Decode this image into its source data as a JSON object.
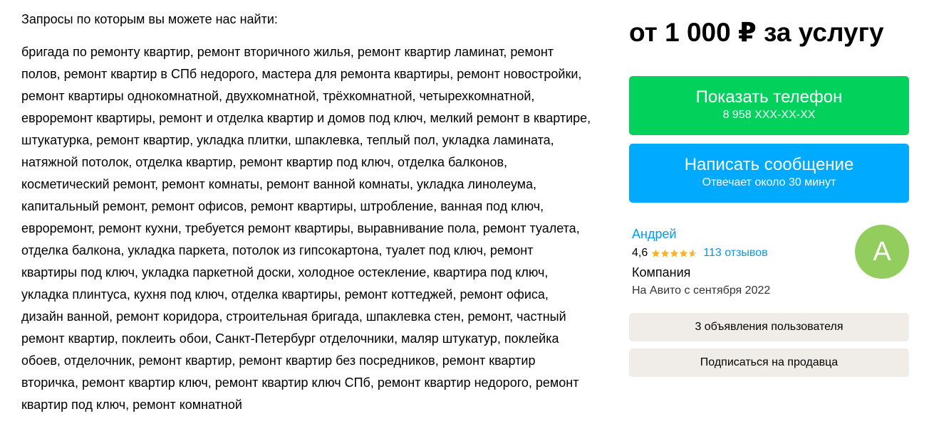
{
  "queries": {
    "heading": "Запросы по которым вы можете нас найти:",
    "text": "бригада по ремонту квартир, ремонт вторичного жилья, ремонт квартир ламинат, ремонт полов, ремонт квартир в СПб недорого, мастера для ремонта квартиры, ремонт новостройки, ремонт квартиры однокомнатной, двухкомнатной, трёхкомнатной, четырехкомнатной, евроремонт квартиры, ремонт и отделка квартир и домов под ключ, мелкий ремонт в квартире, штукатурка, ремонт квартир, укладка плитки, шпаклевка, теплый пол, укладка ламината, натяжной потолок, отделка квартир, ремонт квартир под ключ, отделка балконов, косметический ремонт, ремонт комнаты, ремонт ванной комнаты, укладка линолеума, капитальный ремонт, ремонт офисов, ремонт квартиры, штробление, ванная под ключ, евроремонт, ремонт кухни, требуется ремонт квартиры, выравнивание пола, ремонт туалета, отделка балкона, укладка паркета, потолок из гипсокартона, туалет под ключ, ремонт квартиры под ключ, укладка паркетной доски, холодное остекление, квартира под ключ, укладка плинтуса, кухня под ключ, отделка квартиры, ремонт коттеджей, ремонт офиса, дизайн ванной, ремонт коридора, строительная бригада, шпаклевка стен, ремонт, частный ремонт квартир, поклеить обои, Санкт-Петербург отделочники, маляр штукатур, поклейка обоев, отделочник, ремонт квартир, ремонт квартир без посредников, ремонт квартир вторичка, ремонт квартир ключ, ремонт квартир ключ СПб, ремонт квартир недорого, ремонт квартир под ключ, ремонт комнатной"
  },
  "price": "от 1 000 ₽ за услугу",
  "phone_button": {
    "label": "Показать телефон",
    "number": "8 958 XXX-XX-XX",
    "color": "#02d15c"
  },
  "message_button": {
    "label": "Написать сообщение",
    "note": "Отвечает около 30 минут",
    "color": "#00aaff"
  },
  "seller": {
    "name": "Андрей",
    "rating": "4,6",
    "rating_value": 4.6,
    "rating_max": 5,
    "reviews": "113 отзывов",
    "type": "Компания",
    "since": "На Авито с сентября 2022",
    "avatar_letter": "А",
    "avatar_color": "#92cd5d",
    "star_color": "#ffb021",
    "link_color": "#0099f7"
  },
  "actions": {
    "listings": "3 объявления пользователя",
    "subscribe": "Подписаться на продавца"
  }
}
